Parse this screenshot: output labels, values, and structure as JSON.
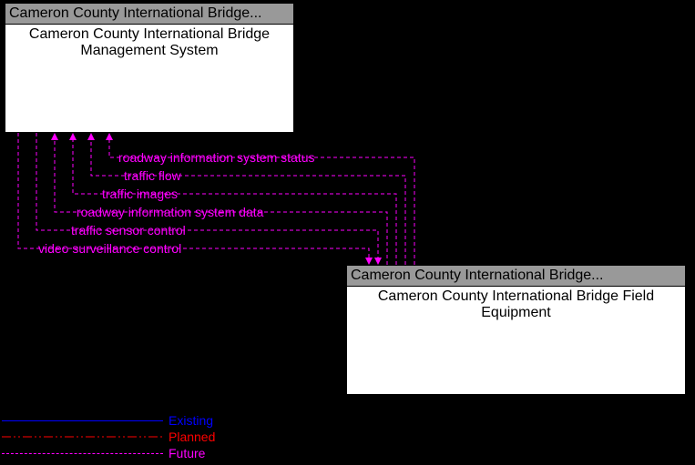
{
  "boxes": {
    "a": {
      "header": "Cameron County International Bridge...",
      "title": "Cameron County International Bridge Management System"
    },
    "b": {
      "header": "Cameron County International Bridge...",
      "title": "Cameron County International Bridge Field Equipment"
    }
  },
  "flows": {
    "status": "roadway information system status",
    "flow": "traffic flow",
    "images": "traffic images",
    "data": "roadway information system data",
    "sensor": "traffic sensor control",
    "video": "video surveillance control"
  },
  "legend": {
    "existing": "Existing",
    "planned": "Planned",
    "future": "Future"
  },
  "colors": {
    "existing": "#0000ff",
    "planned": "#ff0000",
    "future": "#ff00ff"
  },
  "chart_data": {
    "type": "diagram",
    "nodes": [
      {
        "id": "mgmt",
        "owner": "Cameron County International Bridge",
        "label": "Cameron County International Bridge Management System"
      },
      {
        "id": "field",
        "owner": "Cameron County International Bridge",
        "label": "Cameron County International Bridge Field Equipment"
      }
    ],
    "edges": [
      {
        "from": "field",
        "to": "mgmt",
        "label": "roadway information system status",
        "status": "Future"
      },
      {
        "from": "field",
        "to": "mgmt",
        "label": "traffic flow",
        "status": "Future"
      },
      {
        "from": "field",
        "to": "mgmt",
        "label": "traffic images",
        "status": "Future"
      },
      {
        "from": "field",
        "to": "mgmt",
        "label": "roadway information system data",
        "status": "Future"
      },
      {
        "from": "mgmt",
        "to": "field",
        "label": "traffic sensor control",
        "status": "Future"
      },
      {
        "from": "mgmt",
        "to": "field",
        "label": "video surveillance control",
        "status": "Future"
      }
    ],
    "legend": [
      "Existing",
      "Planned",
      "Future"
    ]
  }
}
